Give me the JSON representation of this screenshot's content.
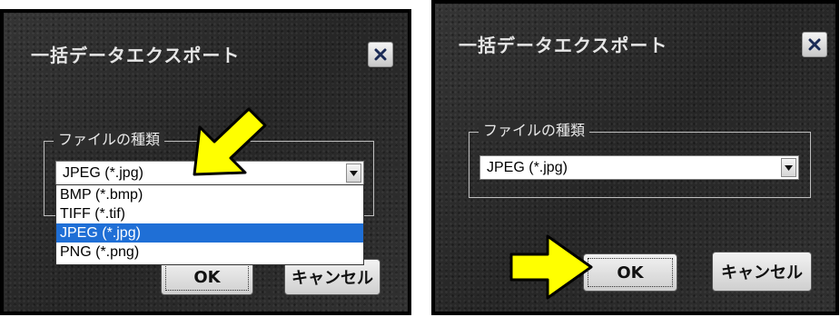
{
  "left_dialog": {
    "title": "一括データエクスポート",
    "group_label": "ファイルの種類",
    "select_value": "JPEG (*.jpg)",
    "dropdown_options": [
      "BMP (*.bmp)",
      "TIFF (*.tif)",
      "JPEG (*.jpg)",
      "PNG (*.png)"
    ],
    "selected_option": "JPEG (*.jpg)",
    "ok_label": "OK",
    "cancel_label": "キャンセル",
    "close_icon": "close-icon"
  },
  "right_dialog": {
    "title": "一括データエクスポート",
    "group_label": "ファイルの種類",
    "select_value": "JPEG (*.jpg)",
    "ok_label": "OK",
    "cancel_label": "キャンセル",
    "close_icon": "close-icon"
  },
  "colors": {
    "highlight_arrow": "#ffff00",
    "selection": "#1f6fd6",
    "panel_bg": "#2c2c2c"
  }
}
